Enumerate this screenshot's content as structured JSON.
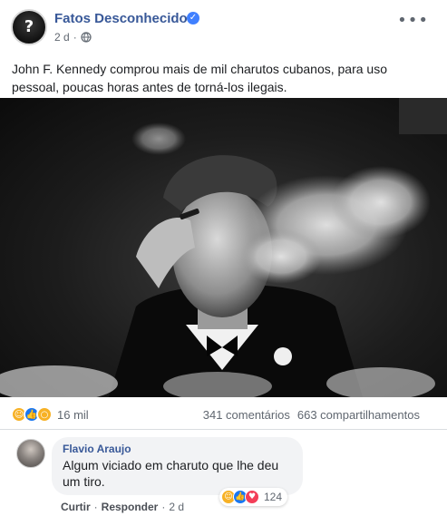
{
  "post": {
    "page_name": "Fatos Desconhecidos",
    "time": "2 d",
    "text": "John F. Kennedy comprou mais de mil charutos cubanos, para uso pessoal, poucas horas antes de torná-los ilegais.",
    "more_icon": "more-options-icon",
    "privacy_icon": "globe-icon"
  },
  "reactions": {
    "types": [
      "haha",
      "like",
      "wow"
    ],
    "count": "16 mil",
    "comments": "341 comentários",
    "shares": "663 compartilhamentos"
  },
  "comment": {
    "author": "Flavio Araujo",
    "text": "Algum viciado em charuto que lhe deu um tiro.",
    "like_label": "Curtir",
    "reply_label": "Responder",
    "separator": "·",
    "time": "2 d",
    "reaction_types": [
      "haha",
      "like",
      "love"
    ],
    "reaction_count": "124"
  },
  "colors": {
    "link_blue": "#385898",
    "secondary_text": "#606770",
    "like_blue": "#1877f2",
    "haha_yellow": "#f7b125",
    "love_red": "#f33e58"
  }
}
